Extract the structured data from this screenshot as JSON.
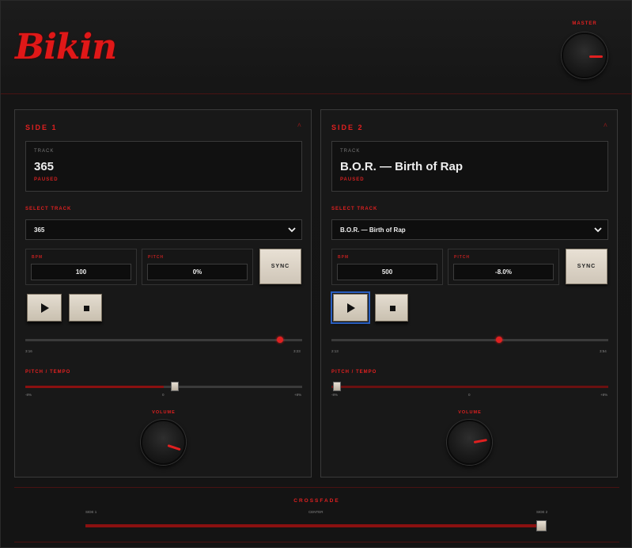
{
  "app": {
    "logo": "Bikin",
    "master_label": "MASTER",
    "master_level": 0.9
  },
  "decks": [
    {
      "title": "SIDE 1",
      "track_label": "TRACK",
      "track_name": "365",
      "status": "PAUSED",
      "select_label": "SELECT TRACK",
      "select_value": "365",
      "bpm_label": "BPM",
      "bpm_value": "100",
      "pitch_label": "PITCH",
      "pitch_value": "0%",
      "sync_label": "SYNC",
      "time_elapsed": "3:16",
      "time_total": "3:23",
      "progress": 0.97,
      "pitch_tempo_label": "PITCH / TEMPO",
      "pitch_min": "-8%",
      "pitch_mid": "0",
      "pitch_max": "+8%",
      "pitch_position": 0.5,
      "volume_label": "VOLUME",
      "volume_level": 0.75,
      "play_focused": false
    },
    {
      "title": "SIDE 2",
      "track_label": "TRACK",
      "track_name": "B.O.R. — Birth of Rap",
      "status": "PAUSED",
      "select_label": "SELECT TRACK",
      "select_value": "B.O.R. — Birth of Rap",
      "bpm_label": "BPM",
      "bpm_value": "500",
      "pitch_label": "PITCH",
      "pitch_value": "-8.0%",
      "sync_label": "SYNC",
      "time_elapsed": "2:13",
      "time_total": "3:54",
      "progress": 0.57,
      "pitch_tempo_label": "PITCH / TEMPO",
      "pitch_min": "-8%",
      "pitch_mid": "0",
      "pitch_max": "+8%",
      "pitch_position": 0.0,
      "volume_label": "VOLUME",
      "volume_level": 0.8,
      "play_focused": true
    }
  ],
  "crossfade": {
    "title": "CROSSFADE",
    "left_label": "SIDE 1",
    "center_label": "CENTER",
    "right_label": "SIDE 2",
    "position": 1.0
  },
  "colors": {
    "accent": "#e02020",
    "panel_border": "#3a3a3a",
    "button_face": "#d8d0c2"
  },
  "icons": {
    "play": "play-icon",
    "stop": "stop-icon",
    "chevron": "chevron-down-icon",
    "collapse": "caret-up-icon"
  }
}
